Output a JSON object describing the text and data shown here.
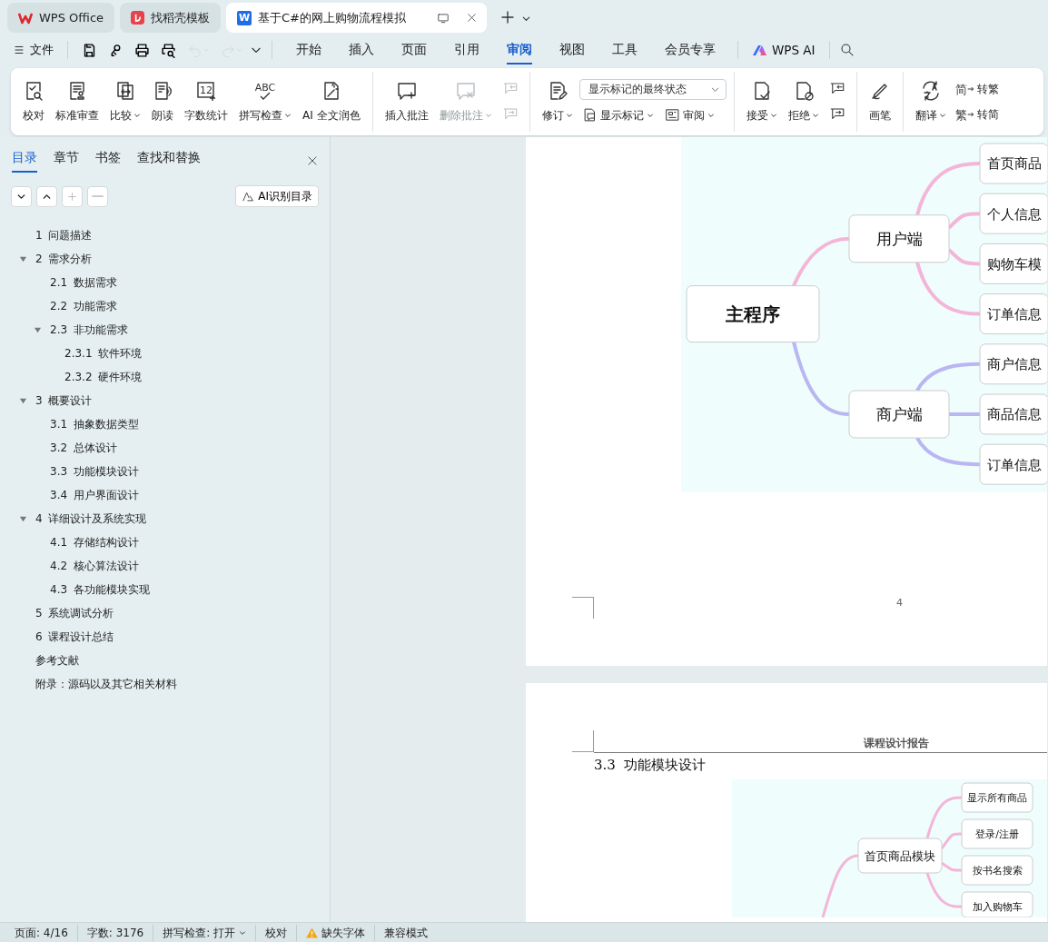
{
  "tabs": [
    {
      "label": "WPS Office",
      "selected": false
    },
    {
      "label": "找稻壳模板",
      "selected": false
    },
    {
      "label": "基于C#的网上购物流程模拟",
      "selected": true,
      "icon_text": "W"
    }
  ],
  "quick_access": [
    {
      "disabled": false
    },
    {
      "disabled": false
    },
    {
      "disabled": false
    },
    {
      "disabled": false
    },
    {
      "disabled": true
    },
    {
      "disabled": true
    }
  ],
  "file_menu": "文件",
  "menu_tabs": [
    {
      "label": "开始",
      "selected": false
    },
    {
      "label": "插入",
      "selected": false
    },
    {
      "label": "页面",
      "selected": false
    },
    {
      "label": "引用",
      "selected": false
    },
    {
      "label": "审阅",
      "selected": true
    },
    {
      "label": "视图",
      "selected": false
    },
    {
      "label": "工具",
      "selected": false
    },
    {
      "label": "会员专享",
      "selected": false
    }
  ],
  "ai_button": "WPS AI",
  "ribbon": {
    "groups": [
      {
        "items": [
          {
            "kind": "large",
            "label": "校对",
            "dropdown": false,
            "disabled": false
          },
          {
            "kind": "large",
            "label": "标准审查",
            "dropdown": false,
            "disabled": false
          },
          {
            "kind": "large",
            "label": "比较",
            "dropdown": true,
            "disabled": false
          },
          {
            "kind": "large",
            "label": "朗读",
            "dropdown": false,
            "disabled": false
          },
          {
            "kind": "large",
            "label": "字数统计",
            "dropdown": false,
            "disabled": false,
            "icon_text": "12"
          },
          {
            "kind": "large",
            "label": "拼写检查",
            "dropdown": true,
            "disabled": false,
            "icon_text": "ABC"
          },
          {
            "kind": "large",
            "label": "AI 全文润色",
            "dropdown": false,
            "disabled": false
          }
        ]
      },
      {
        "items": [
          {
            "kind": "large",
            "label": "插入批注",
            "dropdown": false,
            "disabled": false
          },
          {
            "kind": "large",
            "label": "删除批注",
            "dropdown": true,
            "disabled": true
          },
          {
            "kind": "stack",
            "items": [
              {
                "kind": "icon",
                "dropdown": false,
                "disabled": true
              },
              {
                "kind": "icon",
                "dropdown": false,
                "disabled": true
              }
            ]
          }
        ]
      },
      {
        "items": [
          {
            "kind": "large",
            "label": "修订",
            "dropdown": true,
            "disabled": false
          },
          {
            "kind": "stack",
            "items": [
              {
                "kind": "select",
                "value": "显示标记的最终状态"
              },
              {
                "kind": "row",
                "items": [
                  {
                    "kind": "small",
                    "label": "显示标记",
                    "dropdown": true,
                    "disabled": false
                  },
                  {
                    "kind": "small",
                    "label": "审阅",
                    "dropdown": true,
                    "disabled": false
                  }
                ]
              }
            ]
          }
        ]
      },
      {
        "items": [
          {
            "kind": "large",
            "label": "接受",
            "dropdown": true,
            "disabled": false
          },
          {
            "kind": "large",
            "label": "拒绝",
            "dropdown": true,
            "disabled": false
          },
          {
            "kind": "stack",
            "items": [
              {
                "kind": "icon",
                "dropdown": false,
                "disabled": false
              },
              {
                "kind": "icon",
                "dropdown": false,
                "disabled": false
              }
            ]
          }
        ]
      },
      {
        "items": [
          {
            "kind": "large",
            "label": "画笔",
            "dropdown": false,
            "disabled": false
          }
        ]
      },
      {
        "items": [
          {
            "kind": "large",
            "label": "翻译",
            "dropdown": true,
            "disabled": false
          },
          {
            "kind": "stack",
            "items": [
              {
                "kind": "small",
                "label": "转繁",
                "dropdown": false,
                "disabled": false,
                "icon_text": "简"
              },
              {
                "kind": "small",
                "label": "转简",
                "dropdown": false,
                "disabled": false,
                "icon_text": "繁"
              }
            ]
          }
        ]
      }
    ]
  },
  "nav_panel": {
    "tabs": [
      {
        "label": "目录",
        "selected": true
      },
      {
        "label": "章节",
        "selected": false
      },
      {
        "label": "书签",
        "selected": false
      },
      {
        "label": "查找和替换",
        "selected": false
      }
    ],
    "tool_buttons": [
      {
        "disabled": false
      },
      {
        "disabled": false
      },
      {
        "disabled": true
      },
      {
        "disabled": true
      }
    ],
    "ai_button": "AI识别目录",
    "outline": [
      {
        "label": "1 问题描述"
      },
      {
        "label": "2 需求分析",
        "expanded": true,
        "children": [
          {
            "label": "2.1 数据需求"
          },
          {
            "label": "2.2 功能需求"
          },
          {
            "label": "2.3 非功能需求",
            "expanded": true,
            "children": [
              {
                "label": "2.3.1 软件环境"
              },
              {
                "label": "2.3.2 硬件环境"
              }
            ]
          }
        ]
      },
      {
        "label": "3 概要设计",
        "expanded": true,
        "children": [
          {
            "label": "3.1 抽象数据类型"
          },
          {
            "label": "3.2 总体设计"
          },
          {
            "label": "3.3 功能模块设计"
          },
          {
            "label": "3.4 用户界面设计"
          }
        ]
      },
      {
        "label": "4 详细设计及系统实现",
        "expanded": true,
        "children": [
          {
            "label": "4.1 存储结构设计"
          },
          {
            "label": "4.2 核心算法设计"
          },
          {
            "label": "4.3 各功能模块实现"
          }
        ]
      },
      {
        "label": "5 系统调试分析"
      },
      {
        "label": "6 课程设计总结"
      },
      {
        "label": "参考文献"
      },
      {
        "label": "附录：源码以及其它相关材料"
      }
    ]
  },
  "pages": {
    "page_number": "4",
    "header": "课程设计报告",
    "heading": "3.3  功能模块设计",
    "figure_1": {
      "root": "主程序",
      "branches": [
        {
          "label": "用户端",
          "color": "#f4b5d8",
          "children": [
            "首页商品",
            "个人信息",
            "购物车模",
            "订单信息"
          ]
        },
        {
          "label": "商户端",
          "color": "#b9b6f2",
          "children": [
            "商户信息",
            "商品信息",
            "订单信息"
          ]
        }
      ]
    },
    "figure_2": {
      "node": "首页商品模块",
      "children": [
        "显示所有商品",
        "登录/注册",
        "按书名搜索",
        "加入购物车"
      ]
    }
  },
  "status_bar": [
    {
      "kind": "text",
      "label": "页面: 4/16"
    },
    {
      "kind": "text",
      "label": "字数: 3176"
    },
    {
      "kind": "dropdown",
      "label": "拼写检查: 打开"
    },
    {
      "kind": "text",
      "label": "校对"
    },
    {
      "kind": "warning",
      "label": "缺失字体"
    },
    {
      "kind": "text",
      "label": "兼容模式"
    }
  ]
}
